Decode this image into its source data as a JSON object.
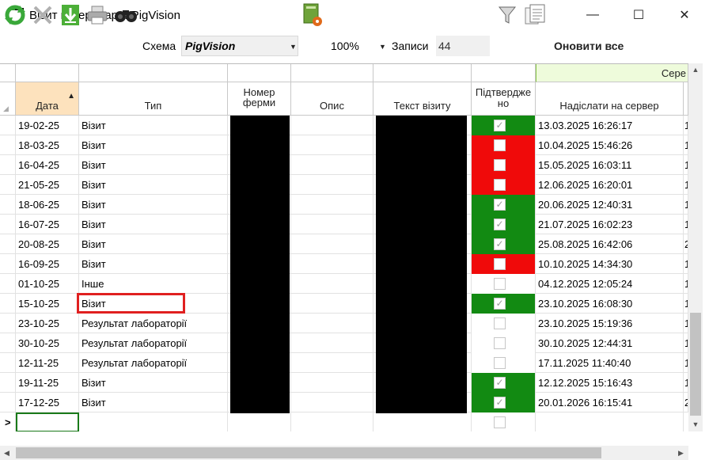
{
  "window": {
    "title": "Візит ветеринара: PigVision",
    "minimize": "—",
    "maximize": "☐",
    "close": "✕"
  },
  "toolbar": {
    "schema_label": "Схема",
    "schema_value": "PigVision",
    "zoom_value": "100%",
    "records_label": "Записи",
    "records_count": "44",
    "refresh_all_label": "Оновити все"
  },
  "grid": {
    "group_header": "Сере",
    "columns": {
      "date": "Дата",
      "type": "Тип",
      "farm_number": "Номер ферми",
      "description": "Опис",
      "visit_text": "Текст візиту",
      "confirmed": "Підтверджено",
      "send_to_server": "Надіслати на сервер"
    },
    "rows": [
      {
        "date": "19-02-25",
        "type": "Візит",
        "confirmed": "green",
        "send": "13.03.2025 16:26:17",
        "extra": "1"
      },
      {
        "date": "18-03-25",
        "type": "Візит",
        "confirmed": "red",
        "send": "10.04.2025 15:46:26",
        "extra": "1"
      },
      {
        "date": "16-04-25",
        "type": "Візит",
        "confirmed": "red",
        "send": "15.05.2025 16:03:11",
        "extra": "1"
      },
      {
        "date": "21-05-25",
        "type": "Візит",
        "confirmed": "red",
        "send": "12.06.2025 16:20:01",
        "extra": "1"
      },
      {
        "date": "18-06-25",
        "type": "Візит",
        "confirmed": "green",
        "send": "20.06.2025 12:40:31",
        "extra": "1"
      },
      {
        "date": "16-07-25",
        "type": "Візит",
        "confirmed": "green",
        "send": "21.07.2025 16:02:23",
        "extra": "1"
      },
      {
        "date": "20-08-25",
        "type": "Візит",
        "confirmed": "green",
        "send": "25.08.2025 16:42:06",
        "extra": "2"
      },
      {
        "date": "16-09-25",
        "type": "Візит",
        "confirmed": "red",
        "send": "10.10.2025 14:34:30",
        "extra": "1"
      },
      {
        "date": "01-10-25",
        "type": "Інше",
        "confirmed": "none",
        "send": "04.12.2025 12:05:24",
        "extra": "1"
      },
      {
        "date": "15-10-25",
        "type": "Візит",
        "confirmed": "green",
        "send": "23.10.2025 16:08:30",
        "extra": "1"
      },
      {
        "date": "23-10-25",
        "type": "Результат лабораторії",
        "confirmed": "none",
        "send": "23.10.2025 15:19:36",
        "extra": "1"
      },
      {
        "date": "30-10-25",
        "type": "Результат лабораторії",
        "confirmed": "none",
        "send": "30.10.2025 12:44:31",
        "extra": "1"
      },
      {
        "date": "12-11-25",
        "type": "Результат лабораторії",
        "confirmed": "none",
        "send": "17.11.2025 11:40:40",
        "extra": "1"
      },
      {
        "date": "19-11-25",
        "type": "Візит",
        "confirmed": "green",
        "send": "12.12.2025 15:16:43",
        "extra": "1"
      },
      {
        "date": "17-12-25",
        "type": "Візит",
        "confirmed": "green",
        "send": "20.01.2026 16:15:41",
        "extra": "2"
      }
    ],
    "new_row_marker": ">"
  },
  "colors": {
    "confirmed_green": "#128a12",
    "confirmed_red": "#f00a0a",
    "header_orange": "#fde2bd",
    "group_header": "#eefbdb",
    "highlight": "#e02020"
  }
}
